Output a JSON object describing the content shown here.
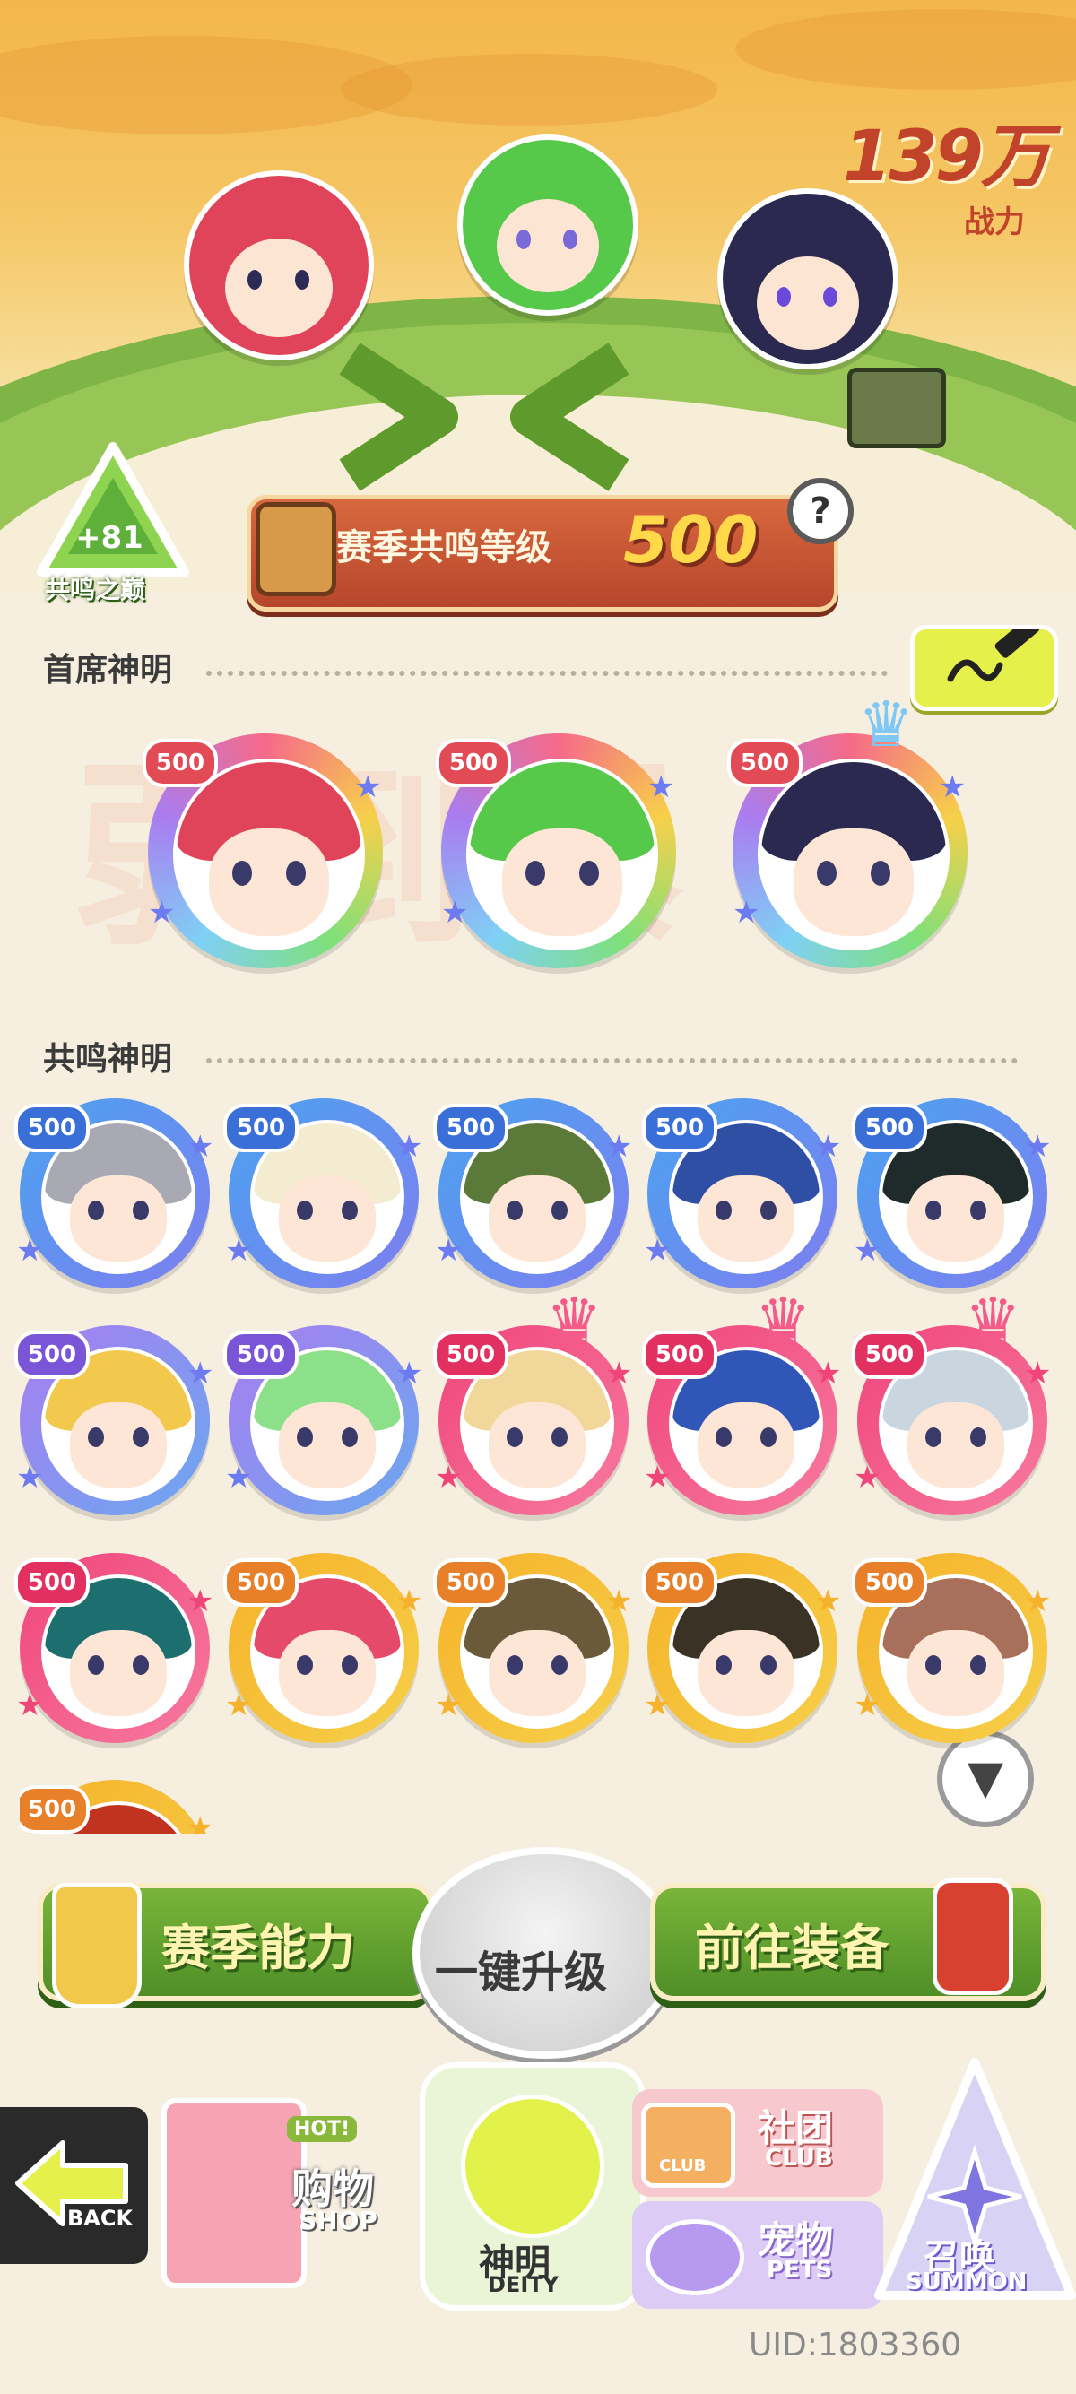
{
  "power": {
    "value": "139万",
    "label": "战力"
  },
  "peak_badge": {
    "bonus": "+81",
    "label": "共鸣之巅"
  },
  "season_banner": {
    "label": "赛季共鸣等级",
    "level": "500",
    "help": "?"
  },
  "watermark": "弱到爆",
  "chief": {
    "title": "首席神明",
    "avatars": [
      {
        "level": "500",
        "hair": "#e0445a",
        "ring": "rainbow",
        "crown": false
      },
      {
        "level": "500",
        "hair": "#57c94a",
        "ring": "rainbow",
        "crown": false
      },
      {
        "level": "500",
        "hair": "#2b2950",
        "ring": "rainbow",
        "crown": true
      }
    ]
  },
  "resonance": {
    "title": "共鸣神明",
    "avatars": [
      {
        "level": "500",
        "hair": "#a9a9b3",
        "ring": "blue",
        "crown": false
      },
      {
        "level": "500",
        "hair": "#f3ecd0",
        "ring": "blue",
        "crown": false
      },
      {
        "level": "500",
        "hair": "#5b7a3a",
        "ring": "blue",
        "crown": false
      },
      {
        "level": "500",
        "hair": "#2f4fa5",
        "ring": "blue",
        "crown": false
      },
      {
        "level": "500",
        "hair": "#1f2b2a",
        "ring": "blue",
        "crown": false
      },
      {
        "level": "500",
        "hair": "#f2c94c",
        "ring": "purple",
        "crown": false
      },
      {
        "level": "500",
        "hair": "#8de08a",
        "ring": "purple",
        "crown": false
      },
      {
        "level": "500",
        "hair": "#f1d89a",
        "ring": "pink",
        "crown": true
      },
      {
        "level": "500",
        "hair": "#3057b8",
        "ring": "pink",
        "crown": true
      },
      {
        "level": "500",
        "hair": "#c9d6e0",
        "ring": "pink",
        "crown": true
      },
      {
        "level": "500",
        "hair": "#1d6e6e",
        "ring": "pink",
        "crown": false
      },
      {
        "level": "500",
        "hair": "#e64a6a",
        "ring": "gold",
        "crown": false
      },
      {
        "level": "500",
        "hair": "#6a5a3a",
        "ring": "gold",
        "crown": false
      },
      {
        "level": "500",
        "hair": "#3a3325",
        "ring": "gold",
        "crown": false
      },
      {
        "level": "500",
        "hair": "#a8705a",
        "ring": "gold",
        "crown": false
      },
      {
        "level": "500",
        "hair": "#c2331f",
        "ring": "gold",
        "crown": false
      }
    ]
  },
  "filter_icon": "filter-icon",
  "actions": {
    "season_ability": "赛季能力",
    "one_key_upgrade": "一键升级",
    "go_equip": "前往装备"
  },
  "nav": {
    "back": "BACK",
    "shop_hot": "HOT!",
    "shop_cn": "购物",
    "shop_en": "SHOP",
    "deity_cn": "神明",
    "deity_en": "DEITY",
    "club_badge": "CLUB",
    "club_cn": "社团",
    "club_en": "CLUB",
    "pets_cn": "宠物",
    "pets_en": "PETS",
    "summon_cn": "召唤",
    "summon_en": "SUMMON"
  },
  "uid": "UID:1803360",
  "ring_colors": {
    "blue": [
      "#4aa3f0",
      "#7f7ef0"
    ],
    "purple": [
      "#a97df0",
      "#6aa8f0"
    ],
    "pink": [
      "#f0457a",
      "#f77aa0"
    ],
    "gold": [
      "#f5b22a",
      "#f7d04a"
    ],
    "rainbow": [
      "#f66a8a",
      "#7fd0f5"
    ]
  },
  "level_colors": {
    "blue": "#3b6fd8",
    "purple": "#7a55d8",
    "pink": "#e23060",
    "gold": "#e8802a",
    "rainbow": "#e24a55"
  }
}
